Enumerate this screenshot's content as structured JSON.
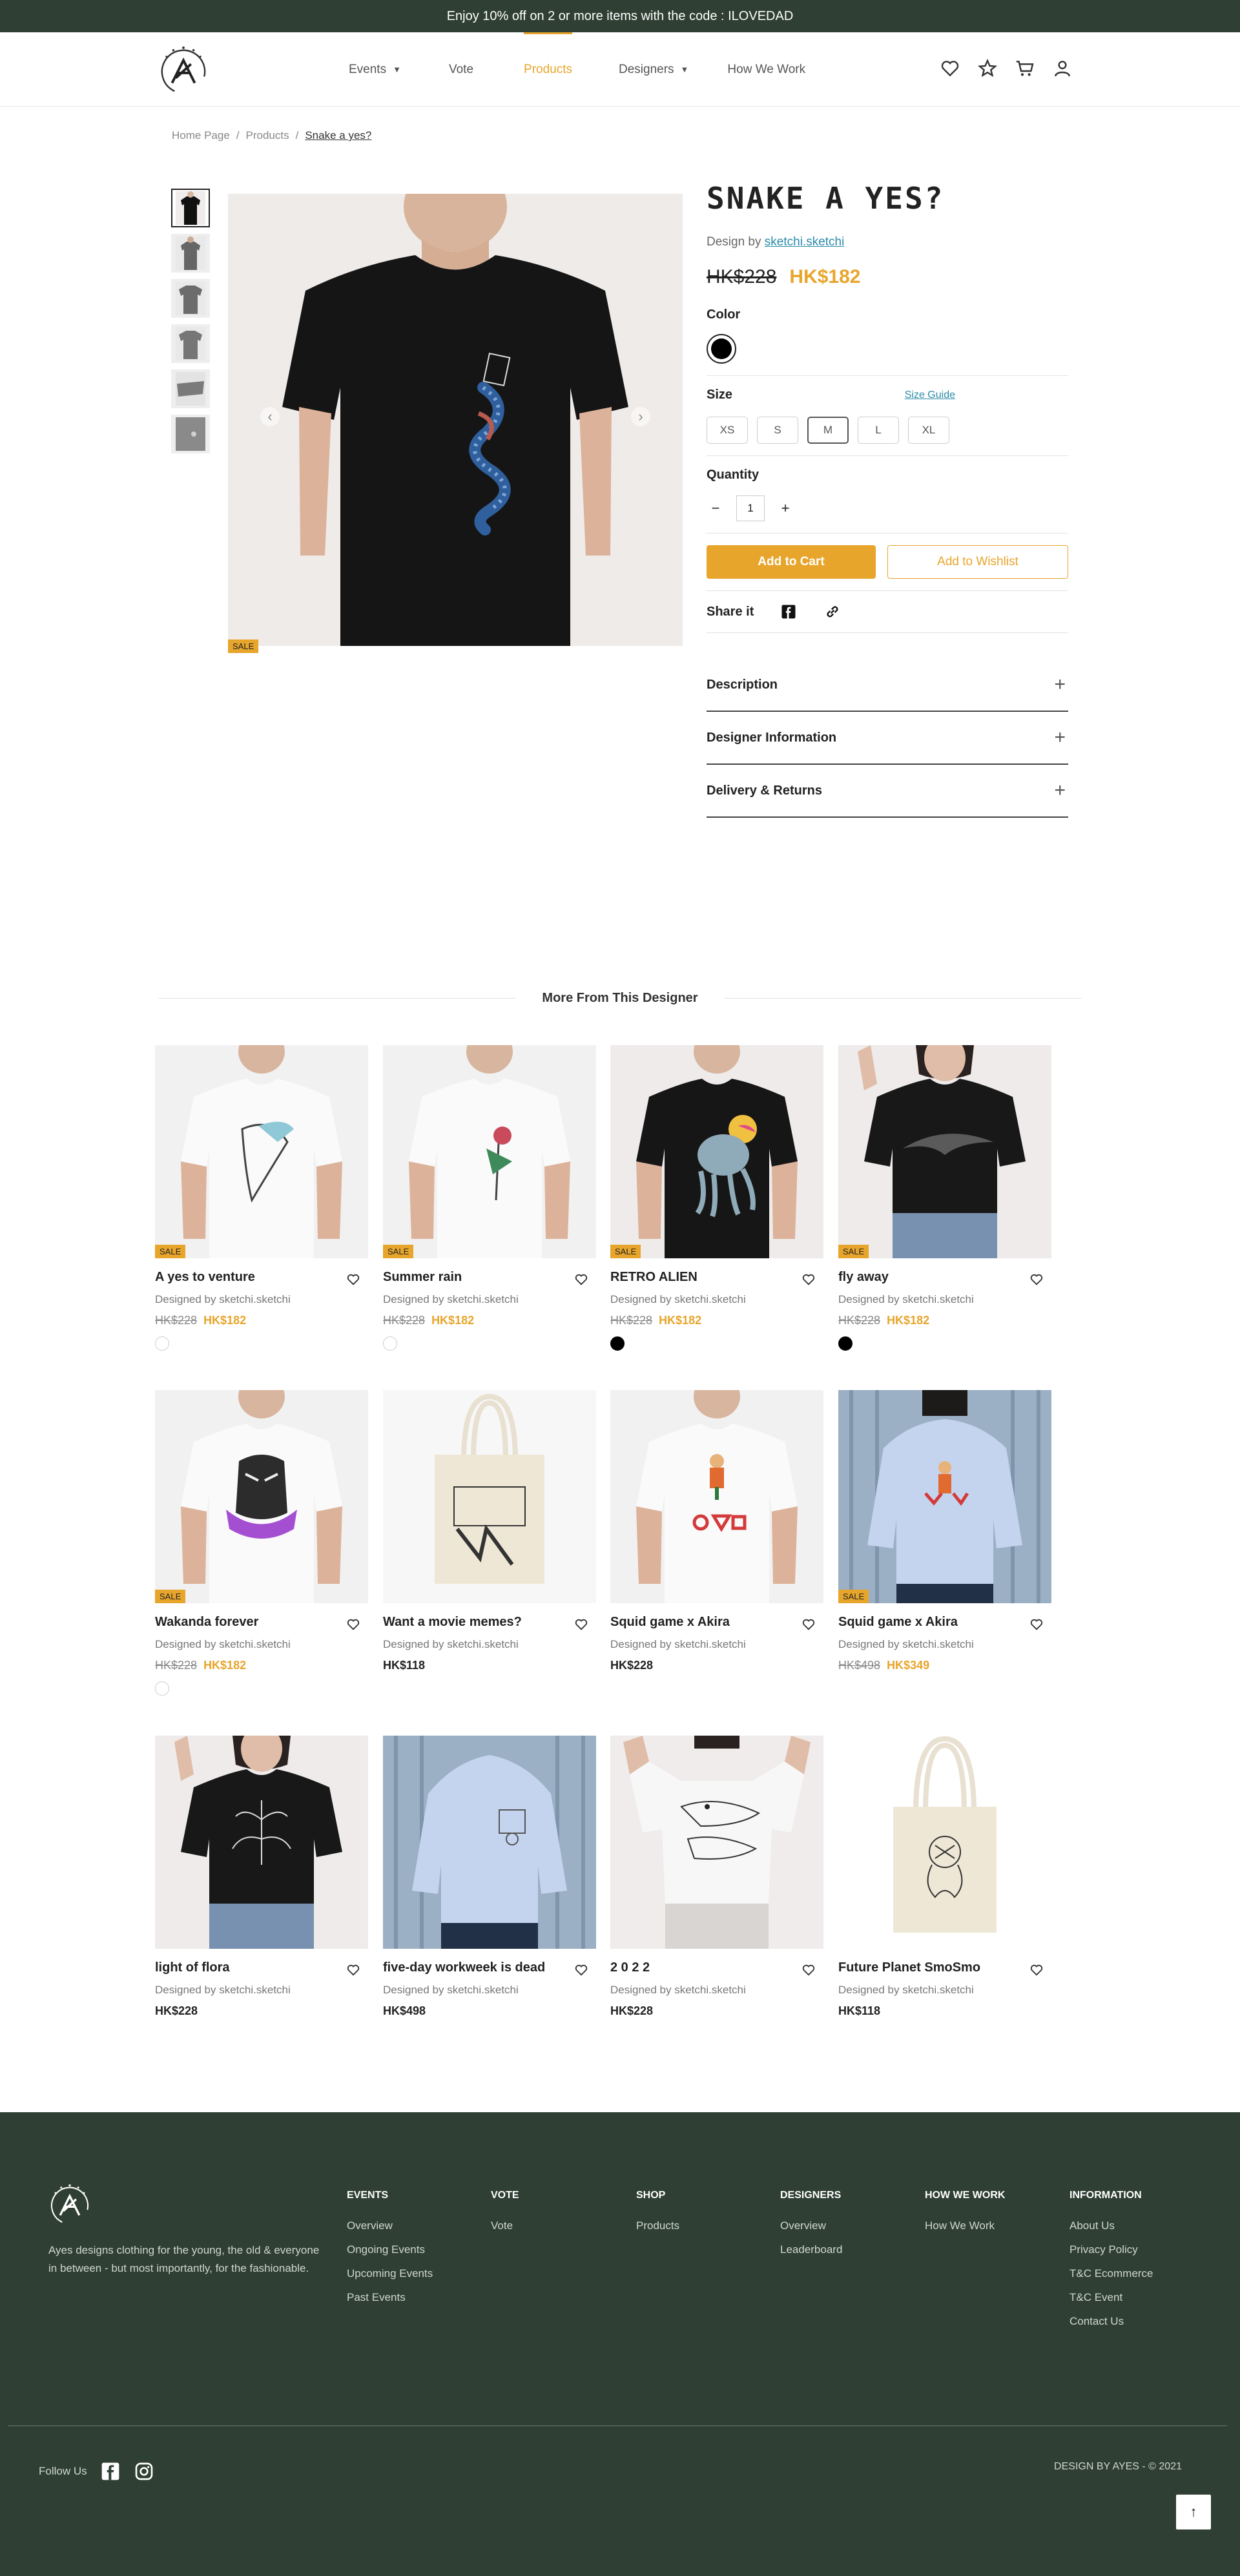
{
  "promo": {
    "text": "Enjoy 10% off on 2 or more items with the code : ILOVEDAD"
  },
  "nav": {
    "events": "Events",
    "vote": "Vote",
    "products": "Products",
    "designers": "Designers",
    "how": "How We Work"
  },
  "breadcrumb": {
    "home": "Home Page",
    "products": "Products",
    "current": "Snake a yes?",
    "sep": "/"
  },
  "product": {
    "title": "SNAKE A YES?",
    "design_by_label": "Design by",
    "designer": "sketchi.sketchi",
    "old_price": "HK$228",
    "new_price": "HK$182",
    "sale_badge": "SALE",
    "color_label": "Color",
    "size_label": "Size",
    "size_guide": "Size Guide",
    "sizes": [
      "XS",
      "S",
      "M",
      "L",
      "XL"
    ],
    "selected_size": "M",
    "quantity_label": "Quantity",
    "quantity": "1",
    "minus": "−",
    "plus": "+",
    "add_to_cart": "Add to Cart",
    "add_to_wishlist": "Add to Wishlist",
    "share_label": "Share it"
  },
  "accordion": {
    "description": "Description",
    "designer_info": "Designer Information",
    "delivery": "Delivery & Returns",
    "plus": "+"
  },
  "more": {
    "title": "More From This Designer",
    "items": [
      {
        "name": "A yes to venture",
        "by": "Designed by sketchi.sketchi",
        "old": "HK$228",
        "price": "HK$182",
        "sale": "SALE"
      },
      {
        "name": "Summer rain",
        "by": "Designed by sketchi.sketchi",
        "old": "HK$228",
        "price": "HK$182",
        "sale": "SALE"
      },
      {
        "name": "RETRO ALIEN",
        "by": "Designed by sketchi.sketchi",
        "old": "HK$228",
        "price": "HK$182",
        "sale": "SALE"
      },
      {
        "name": "fly away",
        "by": "Designed by sketchi.sketchi",
        "old": "HK$228",
        "price": "HK$182",
        "sale": "SALE"
      },
      {
        "name": "Wakanda forever",
        "by": "Designed by sketchi.sketchi",
        "old": "HK$228",
        "price": "HK$182",
        "sale": "SALE"
      },
      {
        "name": "Want a movie memes?",
        "by": "Designed by sketchi.sketchi",
        "price": "HK$118"
      },
      {
        "name": "Squid game x Akira",
        "by": "Designed by sketchi.sketchi",
        "price": "HK$228"
      },
      {
        "name": "Squid game x Akira",
        "by": "Designed by sketchi.sketchi",
        "old": "HK$498",
        "price": "HK$349",
        "sale": "SALE"
      },
      {
        "name": "light of flora",
        "by": "Designed by sketchi.sketchi",
        "price": "HK$228"
      },
      {
        "name": "five-day workweek is dead",
        "by": "Designed by sketchi.sketchi",
        "price": "HK$498"
      },
      {
        "name": "2 0 2 2",
        "by": "Designed by sketchi.sketchi",
        "price": "HK$228"
      },
      {
        "name": "Future Planet SmoSmo",
        "by": "Designed by sketchi.sketchi",
        "price": "HK$118"
      }
    ]
  },
  "footer": {
    "about": "Ayes designs clothing for the young, the old & everyone in between - but most importantly, for the fashionable.",
    "events": {
      "h": "EVENTS",
      "links": [
        "Overview",
        "Ongoing Events",
        "Upcoming Events",
        "Past Events"
      ]
    },
    "vote": {
      "h": "VOTE",
      "links": [
        "Vote"
      ]
    },
    "shop": {
      "h": "SHOP",
      "links": [
        "Products"
      ]
    },
    "designers": {
      "h": "DESIGNERS",
      "links": [
        "Overview",
        "Leaderboard"
      ]
    },
    "how": {
      "h": "HOW WE WORK",
      "links": [
        "How We Work"
      ]
    },
    "info": {
      "h": "INFORMATION",
      "links": [
        "About Us",
        "Privacy Policy",
        "T&C Ecommerce",
        "T&C Event",
        "Contact Us"
      ]
    },
    "follow": "Follow Us",
    "copyright": "DESIGN BY AYES - © 2021",
    "to_top": "↑"
  },
  "colors": {
    "accent": "#e8a52c",
    "footer_bg": "#2f3f33",
    "link": "#2a8ba8"
  }
}
